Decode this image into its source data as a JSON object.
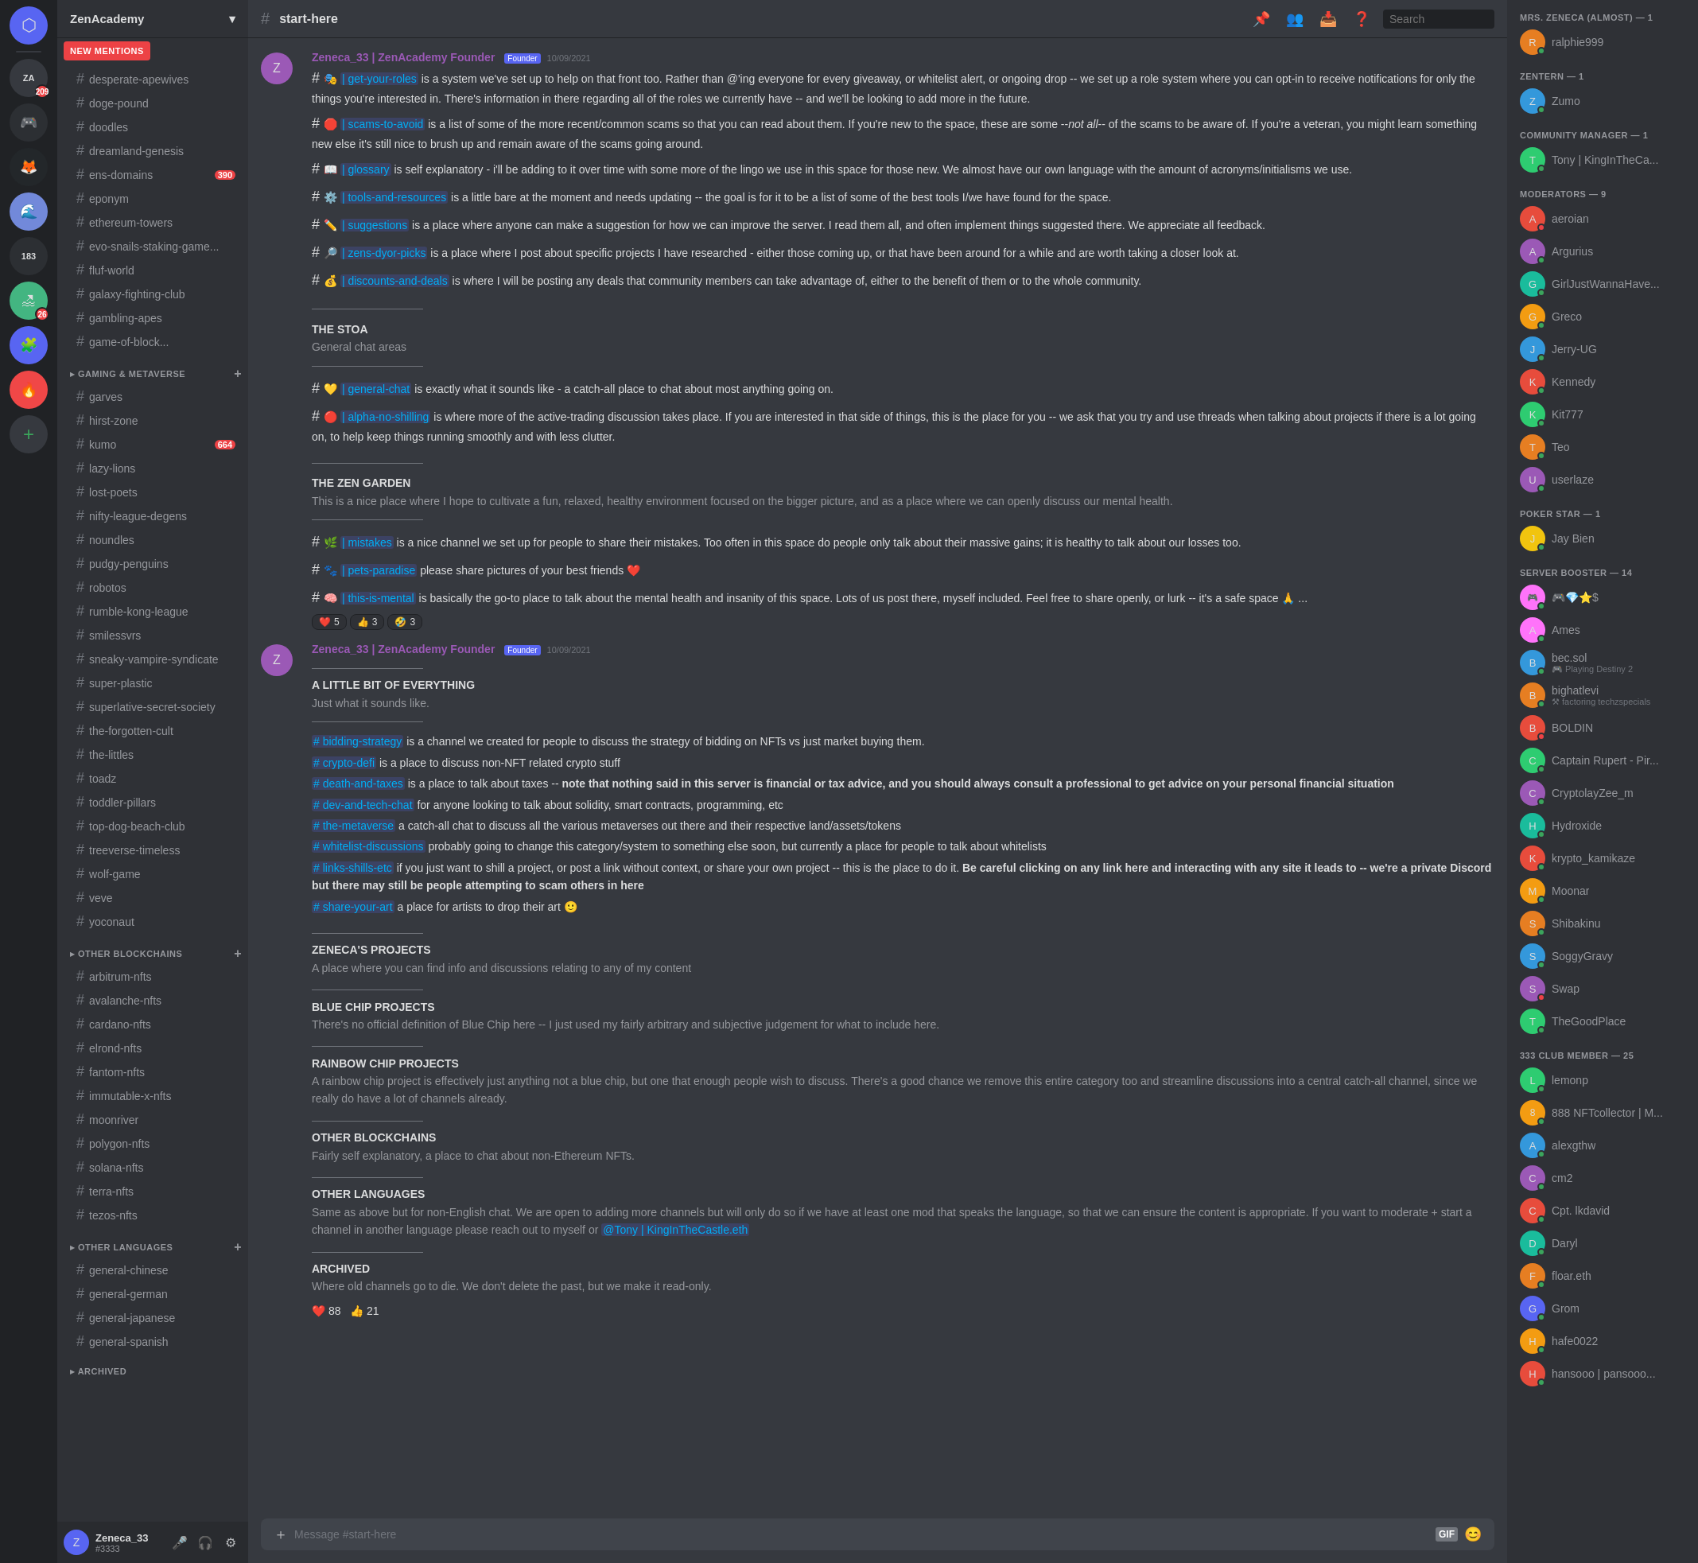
{
  "app": {
    "title": "Discord"
  },
  "server": {
    "name": "ZenAcademy",
    "channel": "start-here"
  },
  "header": {
    "search_placeholder": "Search",
    "channel_name": "start-here"
  },
  "sidebar": {
    "new_mentions": "NEW MENTIONS",
    "categories": [
      {
        "name": "",
        "channels": [
          {
            "name": "desperate-apewives",
            "type": "text",
            "notif": ""
          },
          {
            "name": "doge-pound",
            "type": "text",
            "notif": ""
          },
          {
            "name": "doodles",
            "type": "text",
            "notif": ""
          },
          {
            "name": "dreamland-genesis",
            "type": "text",
            "notif": ""
          },
          {
            "name": "ens-domains",
            "type": "text",
            "notif": "390"
          },
          {
            "name": "eponym",
            "type": "text",
            "notif": ""
          },
          {
            "name": "ethereum-towers",
            "type": "text",
            "notif": ""
          },
          {
            "name": "evo-snails-staking-game...",
            "type": "text",
            "notif": ""
          },
          {
            "name": "fluf-world",
            "type": "text",
            "notif": ""
          },
          {
            "name": "galaxy-fighting-club",
            "type": "text",
            "notif": ""
          },
          {
            "name": "gambling-apes",
            "type": "text",
            "notif": ""
          },
          {
            "name": "game-of-block...",
            "type": "text",
            "notif": ""
          },
          {
            "name": "Gaming & Metaverse",
            "type": "category",
            "notif": ""
          },
          {
            "name": "garves",
            "type": "text",
            "notif": ""
          },
          {
            "name": "hirst-zone",
            "type": "text",
            "notif": ""
          },
          {
            "name": "kumo",
            "type": "text",
            "notif": "664"
          },
          {
            "name": "lazy-lions",
            "type": "text",
            "notif": ""
          },
          {
            "name": "lost-poets",
            "type": "text",
            "notif": ""
          },
          {
            "name": "nifty-league-degens",
            "type": "text",
            "notif": ""
          },
          {
            "name": "noundles",
            "type": "text",
            "notif": ""
          },
          {
            "name": "pudgy-penguins",
            "type": "text",
            "notif": ""
          },
          {
            "name": "robotos",
            "type": "text",
            "notif": ""
          },
          {
            "name": "rumble-kong-league",
            "type": "text",
            "notif": ""
          },
          {
            "name": "smilessvrs",
            "type": "text",
            "notif": ""
          },
          {
            "name": "sneaky-vampire-syndicate",
            "type": "text",
            "notif": ""
          },
          {
            "name": "super-plastic",
            "type": "text",
            "notif": ""
          },
          {
            "name": "superlative-secret-society",
            "type": "text",
            "notif": ""
          },
          {
            "name": "the-forgotten-cult",
            "type": "text",
            "notif": ""
          },
          {
            "name": "the-littles",
            "type": "text",
            "notif": ""
          },
          {
            "name": "toadz",
            "type": "text",
            "notif": ""
          },
          {
            "name": "toddler-pillars",
            "type": "text",
            "notif": ""
          },
          {
            "name": "top-dog-beach-club",
            "type": "text",
            "notif": ""
          },
          {
            "name": "treeverse-timeless",
            "type": "text",
            "notif": ""
          },
          {
            "name": "wolf-game",
            "type": "text",
            "notif": ""
          },
          {
            "name": "veve",
            "type": "text",
            "notif": ""
          },
          {
            "name": "yoconaut",
            "type": "text",
            "notif": ""
          }
        ]
      },
      {
        "name": "OTHER BLOCKCHAINS",
        "channels": [
          {
            "name": "arbitrum-nfts",
            "type": "text"
          },
          {
            "name": "avalanche-nfts",
            "type": "text"
          },
          {
            "name": "cardano-nfts",
            "type": "text"
          },
          {
            "name": "elrond-nfts",
            "type": "text"
          },
          {
            "name": "fantom-nfts",
            "type": "text"
          },
          {
            "name": "immutable-x-nfts",
            "type": "text"
          },
          {
            "name": "moonriver",
            "type": "text"
          },
          {
            "name": "polygon-nfts",
            "type": "text"
          },
          {
            "name": "solana-nfts",
            "type": "text"
          },
          {
            "name": "terra-nfts",
            "type": "text"
          },
          {
            "name": "tezos-nfts",
            "type": "text"
          }
        ]
      },
      {
        "name": "OTHER LANGUAGES",
        "channels": [
          {
            "name": "general-chinese",
            "type": "text"
          },
          {
            "name": "general-german",
            "type": "text"
          },
          {
            "name": "general-japanese",
            "type": "text"
          },
          {
            "name": "general-spanish",
            "type": "text"
          }
        ]
      },
      {
        "name": "ARCHIVED",
        "channels": []
      }
    ]
  },
  "user": {
    "name": "Zeneca_33",
    "tag": "#3333",
    "avatar": "Z"
  },
  "members": {
    "groups": [
      {
        "label": "MRS. ZENECA (ALMOST) — 1",
        "members": [
          {
            "name": "ralphie999",
            "status": "online",
            "avatar": "R",
            "color": "#e67e22"
          }
        ]
      },
      {
        "label": "ZENTERN — 1",
        "members": [
          {
            "name": "Zumo",
            "status": "online",
            "avatar": "Z",
            "color": "#3498db"
          }
        ]
      },
      {
        "label": "COMMUNITY MANAGER — 1",
        "members": [
          {
            "name": "Tony | KingInTheCa...",
            "status": "online",
            "avatar": "T",
            "color": "#2ecc71",
            "subtext": ""
          }
        ]
      },
      {
        "label": "MODERATORS — 9",
        "members": [
          {
            "name": "aeroian",
            "status": "dnd",
            "avatar": "A",
            "color": "#e74c3c"
          },
          {
            "name": "Argurius",
            "status": "online",
            "avatar": "A",
            "color": "#9b59b6"
          },
          {
            "name": "GirlJustWannaHave...",
            "status": "online",
            "avatar": "G",
            "color": "#1abc9c"
          },
          {
            "name": "Greco",
            "status": "online",
            "avatar": "G",
            "color": "#f39c12"
          },
          {
            "name": "Jerry-UG",
            "status": "online",
            "avatar": "J",
            "color": "#3498db"
          },
          {
            "name": "Kennedy",
            "status": "online",
            "avatar": "K",
            "color": "#e74c3c"
          },
          {
            "name": "Kit777",
            "status": "online",
            "avatar": "K",
            "color": "#2ecc71"
          },
          {
            "name": "Teo",
            "status": "online",
            "avatar": "T",
            "color": "#e67e22"
          },
          {
            "name": "userlaze",
            "status": "online",
            "avatar": "U",
            "color": "#9b59b6"
          }
        ]
      },
      {
        "label": "POKER STAR — 1",
        "members": [
          {
            "name": "Jay Bien",
            "status": "online",
            "avatar": "J",
            "color": "#f1c40f"
          }
        ]
      },
      {
        "label": "SERVER BOOSTER — 14",
        "members": [
          {
            "name": "🎮💎⭐$",
            "status": "online",
            "avatar": "🎮",
            "color": "#ff73fa"
          },
          {
            "name": "Ames",
            "status": "online",
            "avatar": "A",
            "color": "#ff73fa"
          },
          {
            "name": "bec.sol",
            "status": "online",
            "avatar": "B",
            "color": "#3498db",
            "subtext": "🎮 Playing Destiny 2"
          },
          {
            "name": "bighatlevi",
            "status": "online",
            "avatar": "B",
            "color": "#e67e22",
            "subtext": "⚒ factoring techzspecials"
          },
          {
            "name": "BOLDIN",
            "status": "dnd",
            "avatar": "B",
            "color": "#e74c3c"
          },
          {
            "name": "Captain Rupert - Pir...",
            "status": "online",
            "avatar": "C",
            "color": "#2ecc71"
          },
          {
            "name": "CryptolayZee_m",
            "status": "online",
            "avatar": "C",
            "color": "#9b59b6"
          },
          {
            "name": "Hydroxide",
            "status": "online",
            "avatar": "H",
            "color": "#1abc9c"
          },
          {
            "name": "krypto_kamikaze",
            "status": "online",
            "avatar": "K",
            "color": "#e74c3c"
          },
          {
            "name": "Moonar",
            "status": "online",
            "avatar": "M",
            "color": "#f39c12"
          },
          {
            "name": "Shibakinu",
            "status": "online",
            "avatar": "S",
            "color": "#e67e22"
          },
          {
            "name": "SoggyGravy",
            "status": "online",
            "avatar": "S",
            "color": "#3498db"
          },
          {
            "name": "Swap",
            "status": "dnd",
            "avatar": "S",
            "color": "#9b59b6"
          },
          {
            "name": "TheGoodPlace",
            "status": "online",
            "avatar": "T",
            "color": "#2ecc71"
          }
        ]
      },
      {
        "label": "333 CLUB MEMBER — 25",
        "members": [
          {
            "name": "lemonp",
            "status": "online",
            "avatar": "L",
            "color": "#2ecc71"
          },
          {
            "name": "888 NFTcollector | M...",
            "status": "online",
            "avatar": "8",
            "color": "#f39c12"
          },
          {
            "name": "alexgthw",
            "status": "online",
            "avatar": "A",
            "color": "#3498db"
          },
          {
            "name": "cm2",
            "status": "online",
            "avatar": "C",
            "color": "#9b59b6"
          },
          {
            "name": "Cpt. lkdavid",
            "status": "online",
            "avatar": "C",
            "color": "#e74c3c"
          },
          {
            "name": "Daryl",
            "status": "online",
            "avatar": "D",
            "color": "#1abc9c"
          },
          {
            "name": "floar.eth",
            "status": "online",
            "avatar": "F",
            "color": "#e67e22"
          },
          {
            "name": "Grom",
            "status": "online",
            "avatar": "G",
            "color": "#5865f2"
          },
          {
            "name": "hafe0022",
            "status": "online",
            "avatar": "H",
            "color": "#f39c12"
          },
          {
            "name": "hansooo | pansooo...",
            "status": "online",
            "avatar": "H",
            "color": "#e74c3c"
          }
        ]
      }
    ]
  },
  "messages": [
    {
      "author": "Zeneca_33 | ZenAcademy Founder",
      "author_color": "#9b59b6",
      "timestamp": "10/09/2021",
      "avatar": "Z",
      "badge": "Founder",
      "lines": [
        "# 🎭 | get-your-roles is a system we've set up to help on that front too. Rather than @'ing everyone for every giveaway, or whitelist alert, or ongoing drop -- we set up a role system where you can opt-in to receive notifications for only the things you're interested in. There's information in there regarding all of the roles we currently have -- and we'll be looking to add more in the future.",
        "# 🛑 | scams-to-avoid is a list of some of the more recent/common scams so that you can read about them. If you're new to the space, these are some --not all-- of the scams to be aware of. If you're a veteran, you might learn something new else it's still nice to brush up and remain aware of the scams going around.",
        "# 📖 | glossary is self explanatory - i'll be adding to it over time with some more of the lingo we use in this space for those new. We almost have our own language with the amount of acronyms/initialisms we use.",
        "# ⚙️ | tools-and-resources is a little bare at the moment and needs updating -- the goal is for it to be a list of some of the best tools I/we have found for the space.",
        "# ✏️ | suggestions is a place where anyone can make a suggestion for how we can improve the server. I read them all, and often implement things suggested there. We appreciate all feedback.",
        "# 🔎 | zens-dyor-picks is a place where I post about specific projects I have researched - either those coming up, or that have been around for a while and are worth taking a closer look at.",
        "# 💰 | discounts-and-deals is where I will be posting any deals that community members can take advantage of, either to the benefit of them or to the whole community.",
        "——————————",
        "THE STOA",
        "General chat areas",
        "——————————",
        "# 💛 | general-chat is exactly what it sounds like - a catch-all place to chat about most anything going on.",
        "# 🔴 | alpha-no-shilling is where more of the active-trading discussion takes place. If you are interested in that side of things, this is the place for you -- we ask that you try and use threads when talking about projects if there is a lot going on, to help keep things running smoothly and with less clutter.",
        "——————————",
        "THE ZEN GARDEN",
        "This is a nice place where I hope to cultivate a fun, relaxed, healthy environment focused on the bigger picture, and as a place where we can openly discuss our mental health.",
        "——————————",
        "# 🌿 | mistakes is a nice channel we set up for people to share their mistakes. Too often in this space do people only talk about their massive gains; it is healthy to talk about our losses too.",
        "# 🐾 | pets-paradise please share pictures of your best friends ❤️",
        "# 🧠 | this-is-mental is basically the go-to place to talk about the mental health and insanity of this space. Lots of us post there, myself included. Feel free to share openly, or lurk -- it's a safe space 🙏 ..."
      ],
      "reactions": [
        {
          "emoji": "❤️",
          "count": "5"
        },
        {
          "emoji": "👍",
          "count": "3"
        },
        {
          "emoji": "🤣",
          "count": "3"
        }
      ]
    },
    {
      "author": "Zeneca_33 | ZenAcademy Founder",
      "author_color": "#9b59b6",
      "timestamp": "10/09/2021",
      "avatar": "Z",
      "badge": "Founder",
      "lines": [
        "——————————",
        "A LITTLE BIT OF EVERYTHING",
        "Just what it sounds like.",
        "——————————",
        "# bidding-strategy is a channel we created for people to discuss the strategy of bidding on NFTs vs just market buying them.",
        "# crypto-defi is a place to discuss non-NFT related crypto stuff",
        "# death-and-taxes is a place to talk about taxes -- note that nothing said in this server is financial or tax advice, and you should always consult a professional to get advice on your personal financial situation",
        "# dev-and-tech-chat for anyone looking to talk about solidity, smart contracts, programming, etc",
        "# the-metaverse a catch-all chat to discuss all the various metaverses out there and their respective land/assets/tokens",
        "# whitelist-discussions probably going to change this category/system to something else soon, but currently a place for people to talk about whitelists",
        "# links-shills-etc if you just want to shill a project, or post a link without context, or share your own project -- this is the place to do it. Be careful clicking on any link here and interacting with any site it leads to -- we're a private Discord but there may still be people attempting to scam others in here",
        "# share-your-art a place for artists to drop their art 🙂",
        "——————————",
        "ZENECA'S PROJECTS",
        "A place where you can find info and discussions relating to any of my content",
        "——————————",
        "BLUE CHIP PROJECTS",
        "There's no official definition of Blue Chip here -- I just used my fairly arbitrary and subjective judgement for what to include here.",
        "——————————",
        "RAINBOW CHIP PROJECTS",
        "A rainbow chip project is effectively just anything not a blue chip, but one that enough people wish to discuss. There's a good chance we remove this entire category too and streamline discussions into a central catch-all channel, since we really do have a lot of channels already.",
        "——————————",
        "OTHER BLOCKCHAINS",
        "Fairly self explanatory, a place to chat about non-Ethereum NFTs.",
        "——————————",
        "OTHER LANGUAGES",
        "Same as above but for non-English chat. We are open to adding more channels but will only do so if we have at least one mod that speaks the language, so that we can ensure the content is appropriate. If you want to moderate + start a channel in another language please reach out to myself or @Tony | KingInTheCastle.eth",
        "——————————",
        "ARCHIVED",
        "Where old channels go to die. We don't delete the past, but we make it read-only.",
        "❤️ 88   👍 21"
      ]
    }
  ],
  "input": {
    "placeholder": "Message #start-here"
  }
}
